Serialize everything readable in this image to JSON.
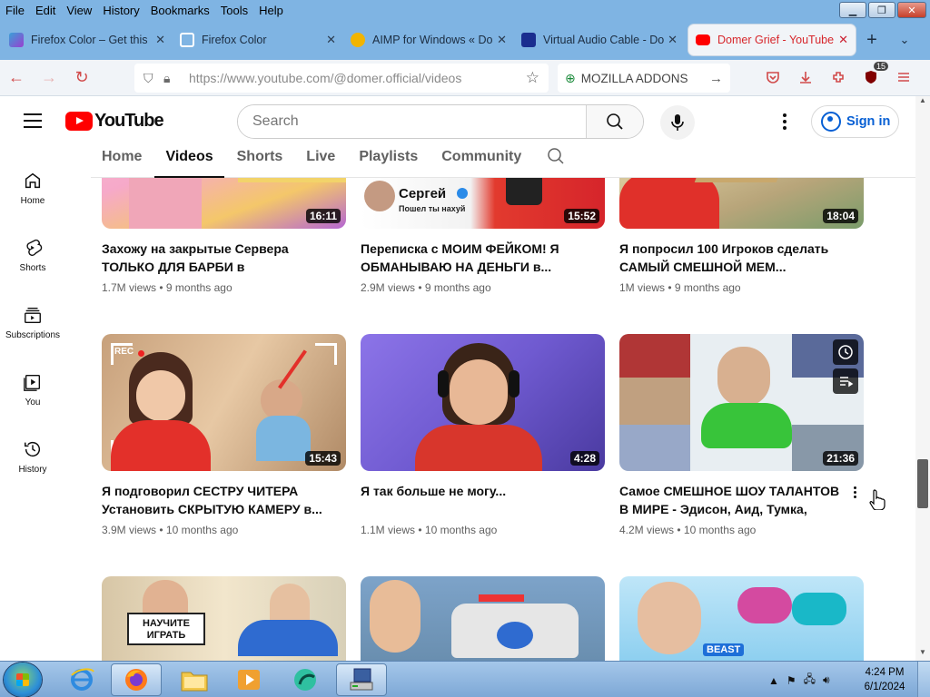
{
  "menubar": {
    "items": [
      "File",
      "Edit",
      "View",
      "History",
      "Bookmarks",
      "Tools",
      "Help"
    ]
  },
  "tabs": [
    {
      "label": "Firefox Color – Get this E",
      "active": false
    },
    {
      "label": "Firefox Color",
      "active": false
    },
    {
      "label": "AIMP for Windows « Do",
      "active": false
    },
    {
      "label": "Virtual Audio Cable - Do",
      "active": false
    },
    {
      "label": "Domer Grief - YouTube",
      "active": true
    }
  ],
  "navbar": {
    "url": "https://www.youtube.com/@domer.official/videos",
    "addons_label": "MOZILLA ADDONS",
    "extension_badge": "15"
  },
  "youtube": {
    "logo_text": "YouTube",
    "search_placeholder": "Search",
    "signin_label": "Sign in",
    "channel_tabs": [
      "Home",
      "Videos",
      "Shorts",
      "Live",
      "Playlists",
      "Community"
    ],
    "active_tab": "Videos",
    "sidebar": [
      {
        "label": "Home",
        "icon": "home-icon"
      },
      {
        "label": "Shorts",
        "icon": "shorts-icon"
      },
      {
        "label": "Subscriptions",
        "icon": "subscriptions-icon"
      },
      {
        "label": "You",
        "icon": "you-icon"
      },
      {
        "label": "History",
        "icon": "history-icon"
      }
    ],
    "videos": [
      {
        "title": "Захожу на закрытые Сервера ТОЛЬКО ДЛЯ БАРБИ в Майнкрафт...",
        "views": "1.7M views",
        "age": "9 months ago",
        "duration": "16:11",
        "thumb": [
          "#f6a9c9",
          "#ffd3e6",
          "#f4c76a"
        ]
      },
      {
        "title": "Переписка с МОИМ ФЕЙКОМ! Я ОБМАНЫВАЮ НА ДЕНЬГИ в...",
        "views": "2.9M views",
        "age": "9 months ago",
        "duration": "15:52",
        "thumb": [
          "#ffffff",
          "#f0f0f0",
          "#d6252b"
        ],
        "overlay_name": "Сергей",
        "overlay_sub": "Пошел ты нахуй"
      },
      {
        "title": "Я попросил 100 Игроков сделать САМЫЙ СМЕШНОЙ МЕМ...",
        "views": "1M views",
        "age": "9 months ago",
        "duration": "18:04",
        "thumb": [
          "#b8a57a",
          "#d8c79a",
          "#e0302a"
        ]
      },
      {
        "title": "Я подговорил СЕСТРУ ЧИТЕРА Установить СКРЫТУЮ КАМЕРУ в...",
        "views": "3.9M views",
        "age": "10 months ago",
        "duration": "15:43",
        "thumb": [
          "#c7a07b",
          "#e7c8a4",
          "#e3302a"
        ],
        "overlay_rec": "REC"
      },
      {
        "title": "Я так больше не могу...",
        "views": "1.1M views",
        "age": "10 months ago",
        "duration": "4:28",
        "thumb": [
          "#6f5ad0",
          "#9a7ef0",
          "#d8362c"
        ]
      },
      {
        "title": "Самое СМЕШНОЕ ШОУ ТАЛАНТОВ В МИРЕ - Эдисон, Аид, Тумка, Градус,...",
        "views": "4.2M views",
        "age": "10 months ago",
        "duration": "21:36",
        "thumb": [
          "#c9d6e0",
          "#e8eef2",
          "#38c43a"
        ],
        "hovered": true
      },
      {
        "title": "",
        "views": "",
        "age": "",
        "duration": "",
        "thumb": [
          "#d7c6a6",
          "#f2e6cc",
          "#2f6bd0"
        ],
        "overlay_sign": "НАУЧИТЕ ИГРАТЬ"
      },
      {
        "title": "",
        "views": "",
        "age": "",
        "duration": "",
        "thumb": [
          "#7da3c9",
          "#3f6fb4",
          "#e6e6e6"
        ]
      },
      {
        "title": "",
        "views": "",
        "age": "",
        "duration": "",
        "thumb": [
          "#8fd0f0",
          "#5fb8e8",
          "#d44aa0"
        ],
        "overlay_beast": "BEAST"
      }
    ]
  },
  "taskbar": {
    "time": "4:24 PM",
    "date": "6/1/2024"
  },
  "colors": {
    "chrome": "#7fb4e3",
    "accent_red": "#ff0000",
    "link_blue": "#065fd4"
  }
}
